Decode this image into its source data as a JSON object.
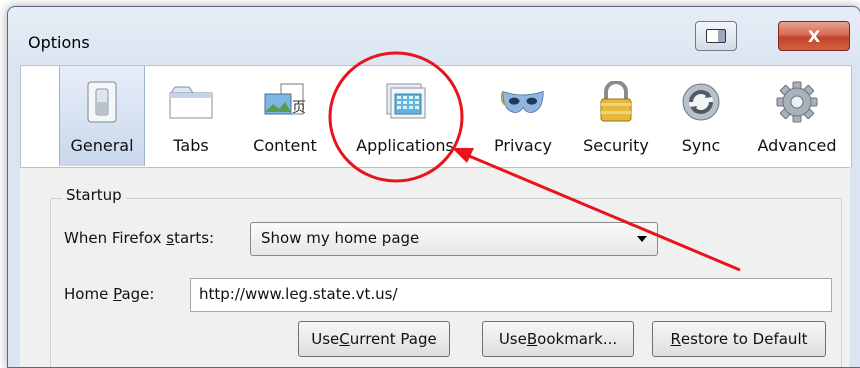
{
  "window": {
    "title": "Options",
    "close_label": "X"
  },
  "tabs": [
    {
      "label": "General",
      "icon": "general-switch-icon",
      "selected": true
    },
    {
      "label": "Tabs",
      "icon": "tabs-icon",
      "selected": false
    },
    {
      "label": "Content",
      "icon": "content-icon",
      "selected": false
    },
    {
      "label": "Applications",
      "icon": "applications-icon",
      "selected": false
    },
    {
      "label": "Privacy",
      "icon": "privacy-mask-icon",
      "selected": false
    },
    {
      "label": "Security",
      "icon": "security-lock-icon",
      "selected": false
    },
    {
      "label": "Sync",
      "icon": "sync-icon",
      "selected": false
    },
    {
      "label": "Advanced",
      "icon": "advanced-gear-icon",
      "selected": false
    }
  ],
  "startup": {
    "group_label": "Startup",
    "when_starts_label_pre": "When Firefox ",
    "when_starts_label_key": "s",
    "when_starts_label_post": "tarts:",
    "when_starts_value": "Show my home page",
    "home_page_label_pre": "Home ",
    "home_page_label_key": "P",
    "home_page_label_post": "age:",
    "home_page_value": "http://www.leg.state.vt.us/"
  },
  "buttons": {
    "use_current_pre": "Use ",
    "use_current_key": "C",
    "use_current_post": "urrent Page",
    "use_bookmark_pre": "Use ",
    "use_bookmark_key": "B",
    "use_bookmark_post": "ookmark...",
    "restore_pre": "",
    "restore_key": "R",
    "restore_post": "estore to Default"
  },
  "annotation": {
    "color": "#e8141c"
  }
}
